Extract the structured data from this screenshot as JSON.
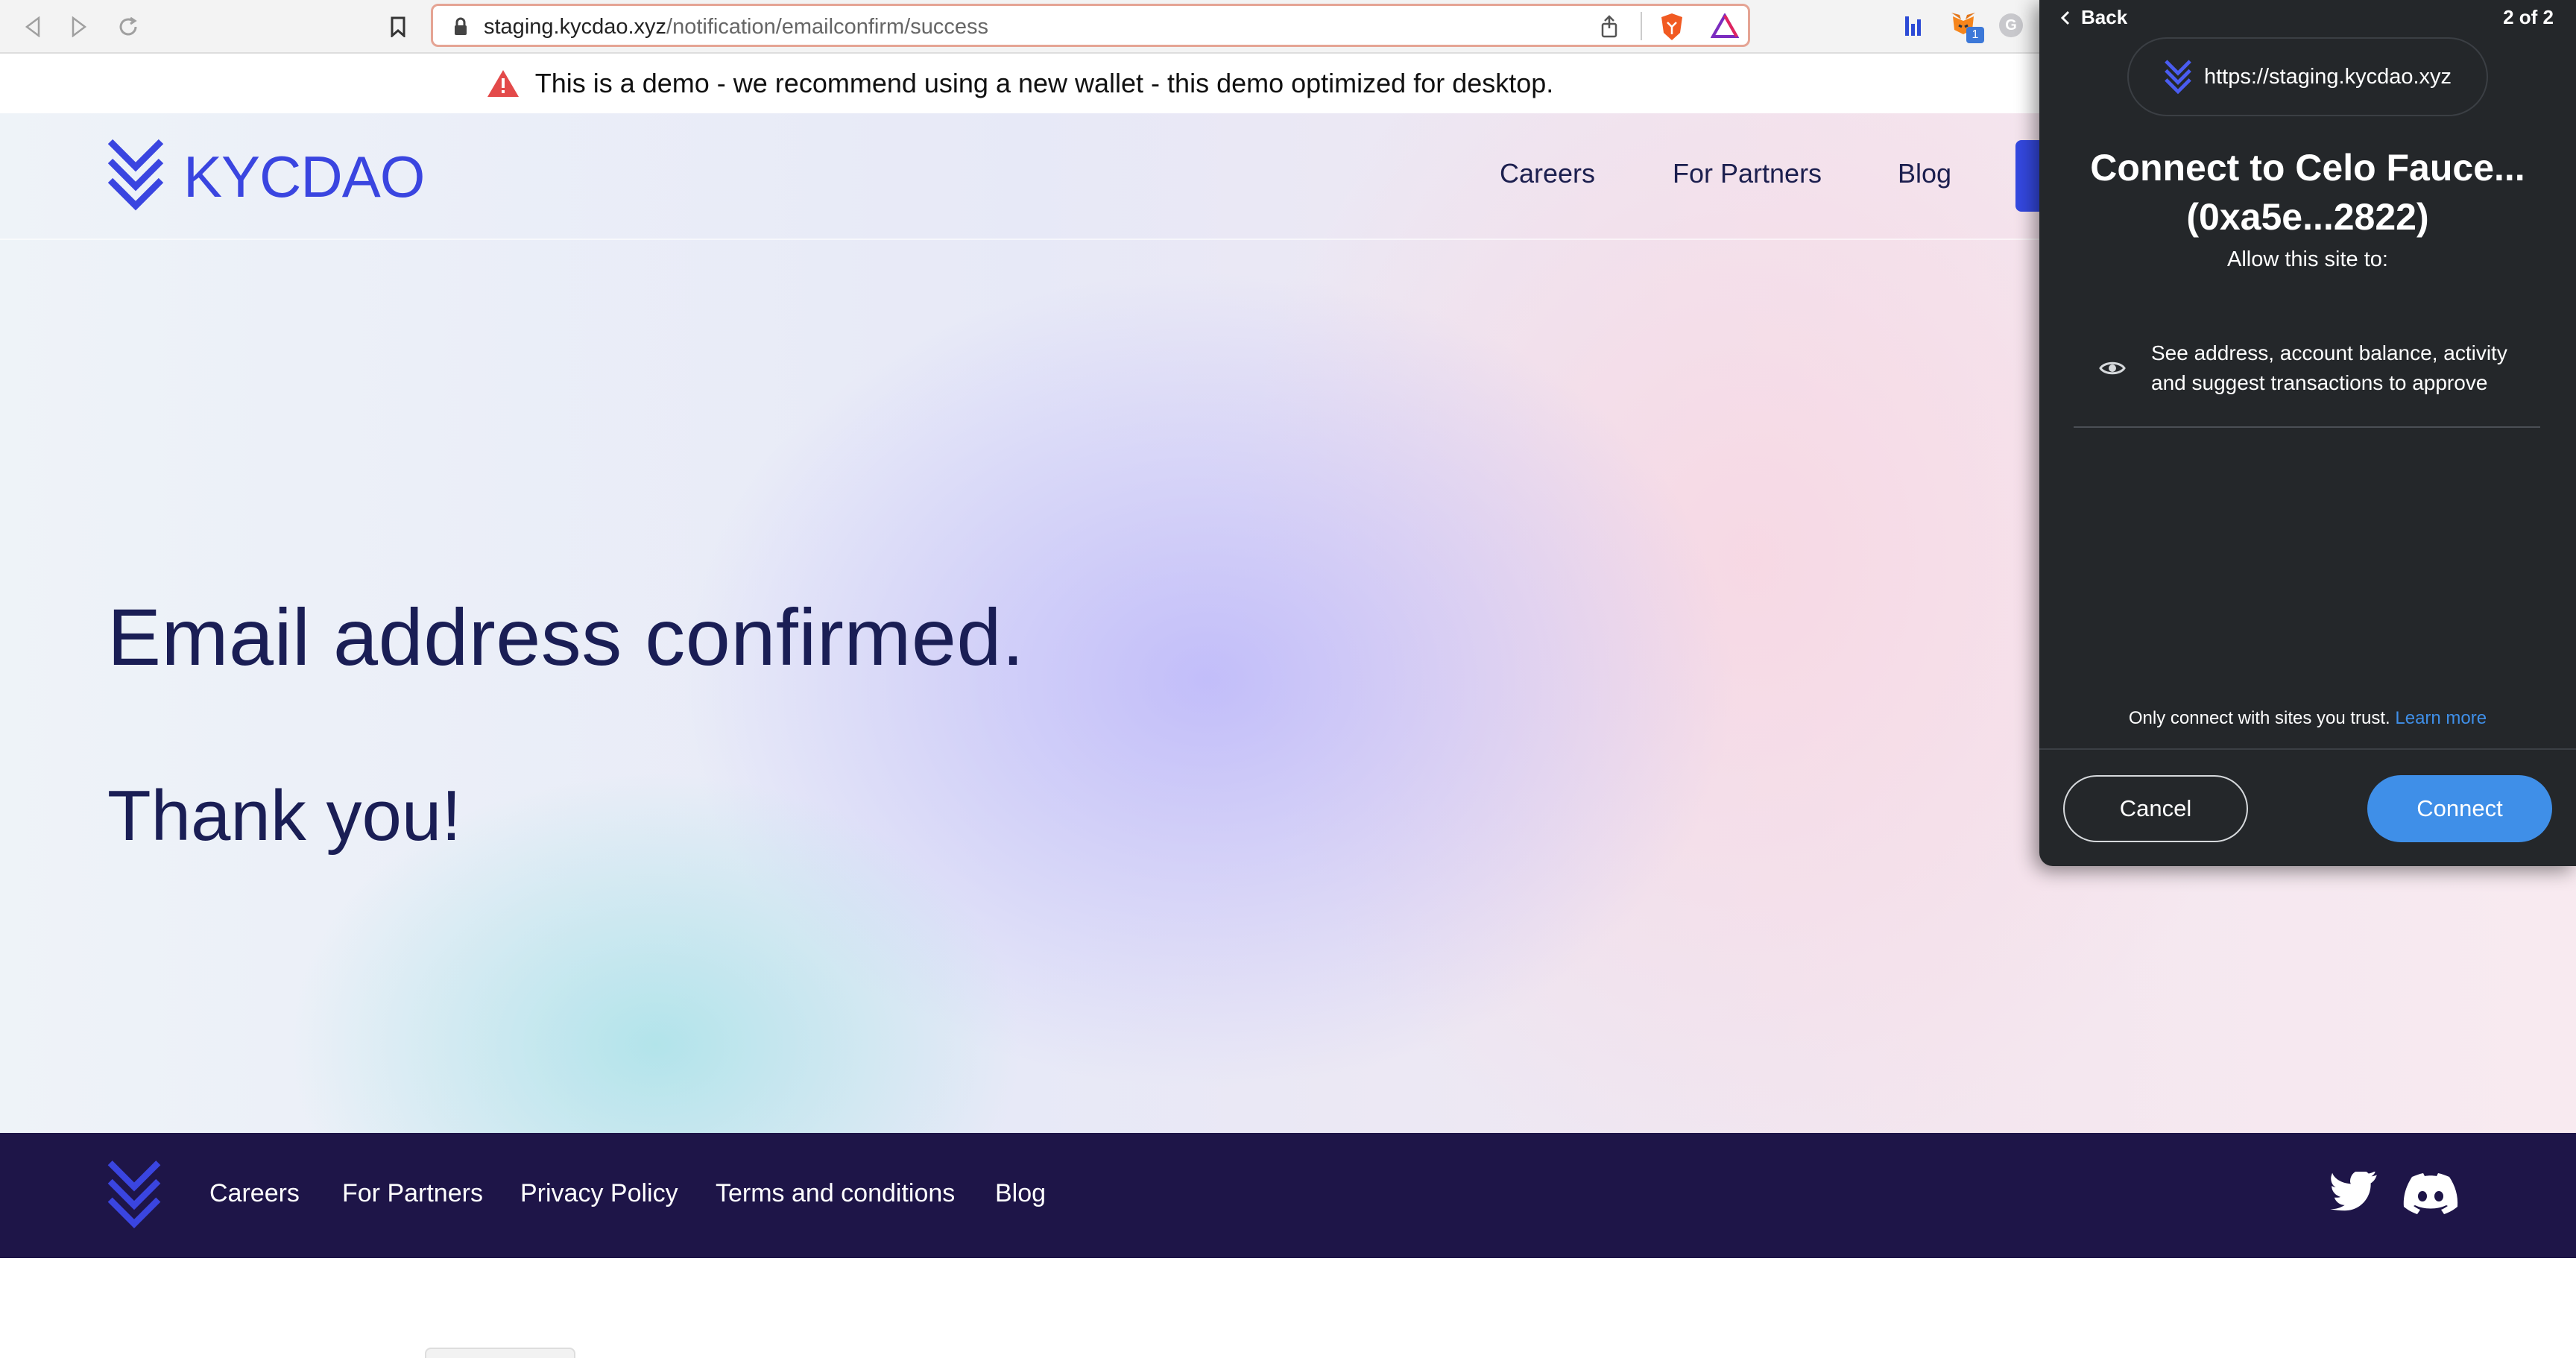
{
  "browser": {
    "url_domain": "staging.kycdao.xyz",
    "url_path": "/notification/emailconfirm/success",
    "extension_badge": "1"
  },
  "banner": {
    "text": "This is a demo - we recommend using a new wallet - this demo optimized for desktop."
  },
  "site": {
    "logo_text": "KYCDAO",
    "nav": [
      "Careers",
      "For Partners",
      "Blog"
    ],
    "heading": "Email address confirmed.",
    "subheading": "Thank you!"
  },
  "footer": {
    "links": [
      "Careers",
      "For Partners",
      "Privacy Policy",
      "Terms and conditions",
      "Blog"
    ]
  },
  "wallet_popup": {
    "back_label": "Back",
    "page_counter": "2 of 2",
    "site_url": "https://staging.kycdao.xyz",
    "title_line1": "Connect to Celo Fauce...",
    "title_line2": "(0xa5e...2822)",
    "allow_label": "Allow this site to:",
    "permission_text": "See address, account balance, activity and suggest transactions to approve",
    "trust_text": "Only connect with sites you trust.",
    "learn_more": "Learn more",
    "cancel_label": "Cancel",
    "connect_label": "Connect"
  },
  "colors": {
    "brand_blue": "#3a45e0",
    "footer_bg": "#1e1548",
    "popup_bg": "#24272a",
    "accent": "#3f8fe8"
  }
}
